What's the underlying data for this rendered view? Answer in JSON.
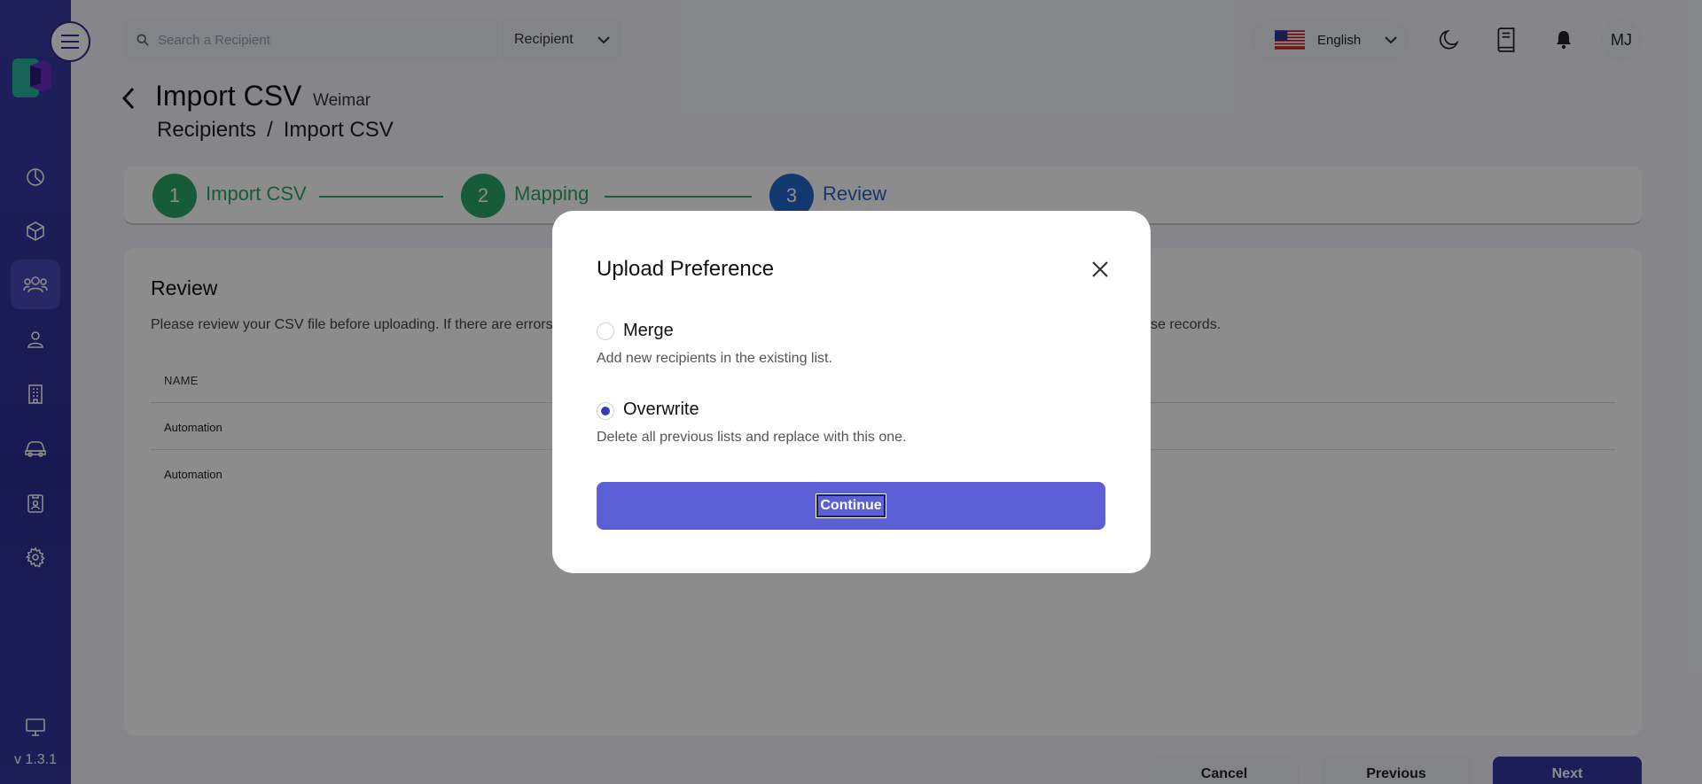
{
  "app": {
    "version": "v 1.3.1"
  },
  "sidebar": {
    "items": [
      {
        "icon": "dashboard-icon"
      },
      {
        "icon": "package-icon"
      },
      {
        "icon": "recipients-icon",
        "active": true
      },
      {
        "icon": "user-icon"
      },
      {
        "icon": "building-icon"
      },
      {
        "icon": "car-icon"
      },
      {
        "icon": "badge-icon"
      },
      {
        "icon": "gear-icon"
      }
    ],
    "bottom_icon": "monitor-icon"
  },
  "topbar": {
    "search_placeholder": "Search a Recipient",
    "search_scope": "Recipient",
    "language": "English",
    "user_initials": "MJ"
  },
  "header": {
    "title": "Import CSV",
    "subtitle": "Weimar",
    "breadcrumb": [
      "Recipients",
      "/",
      "Import CSV"
    ]
  },
  "stepper": {
    "steps": [
      {
        "number": "1",
        "label": "Import CSV",
        "state": "complete"
      },
      {
        "number": "2",
        "label": "Mapping",
        "state": "complete"
      },
      {
        "number": "3",
        "label": "Review",
        "state": "current"
      }
    ],
    "colors": {
      "complete": "#2aa866",
      "current": "#2266cc"
    }
  },
  "review": {
    "title": "Review",
    "description": "Please review your CSV file before uploading. If there are errors,",
    "description_tail": "se records.",
    "column_header": "NAME",
    "rows": [
      "Automation",
      "Automation"
    ]
  },
  "footer": {
    "cancel_label": "Cancel",
    "previous_label": "Previous",
    "next_label": "Next"
  },
  "modal": {
    "title": "Upload Preference",
    "options": [
      {
        "label": "Merge",
        "description": "Add new recipients in the existing list.",
        "selected": false
      },
      {
        "label": "Overwrite",
        "description": "Delete all previous lists and replace with this one.",
        "selected": true
      }
    ],
    "continue_label": "Continue",
    "accent_color": "#5c5fd6"
  }
}
